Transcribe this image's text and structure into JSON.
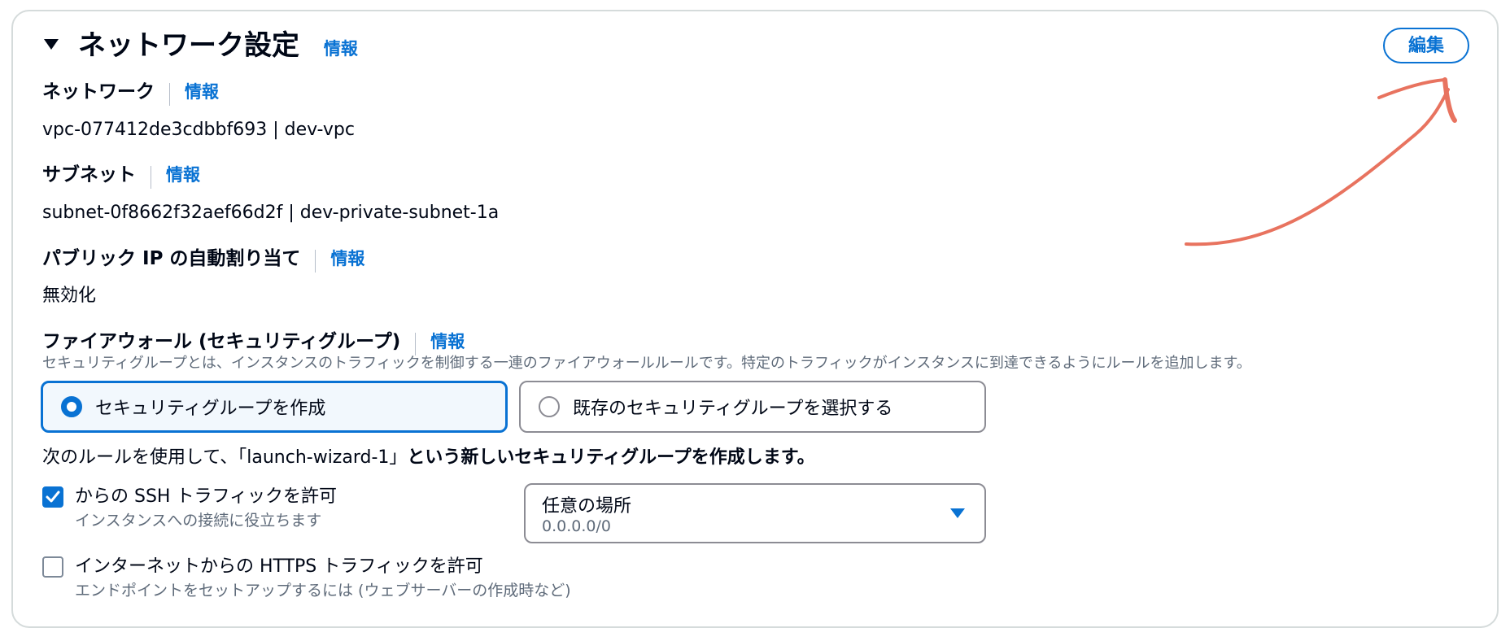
{
  "section": {
    "title": "ネットワーク設定",
    "info": "情報",
    "edit_label": "編集"
  },
  "network": {
    "label": "ネットワーク",
    "info": "情報",
    "value": "vpc-077412de3cdbbf693 | dev-vpc"
  },
  "subnet": {
    "label": "サブネット",
    "info": "情報",
    "value": "subnet-0f8662f32aef66d2f | dev-private-subnet-1a"
  },
  "public_ip": {
    "label": "パブリック IP の自動割り当て",
    "info": "情報",
    "value": "無効化"
  },
  "firewall": {
    "label": "ファイアウォール (セキュリティグループ)",
    "info": "情報",
    "description": "セキュリティグループとは、インスタンスのトラフィックを制御する一連のファイアウォールルールです。特定のトラフィックがインスタンスに到達できるようにルールを追加します。",
    "options": [
      {
        "label": "セキュリティグループを作成",
        "selected": true
      },
      {
        "label": "既存のセキュリティグループを選択する",
        "selected": false
      }
    ]
  },
  "rules": {
    "intro_prefix": "次のルールを使用して、「launch-wizard-1」",
    "intro_suffix": "という新しいセキュリティグループを作成します。",
    "ssh": {
      "label": "からの SSH トラフィックを許可",
      "description": "インスタンスへの接続に役立ちます",
      "checked": true,
      "source": {
        "value": "任意の場所",
        "cidr": "0.0.0.0/0"
      }
    },
    "https": {
      "label": "インターネットからの HTTPS トラフィックを許可",
      "description": "エンドポイントをセットアップするには (ウェブサーバーの作成時など)",
      "checked": false
    }
  },
  "colors": {
    "accent": "#0972d3",
    "annotation_arrow": "#e8735f"
  },
  "icons": {
    "collapse": "caret-down-icon",
    "radio_selected": "radio-selected-icon",
    "radio_unselected": "radio-unselected-icon",
    "checkbox_checked": "checkmark-icon",
    "dropdown": "caret-down-filled-icon"
  }
}
